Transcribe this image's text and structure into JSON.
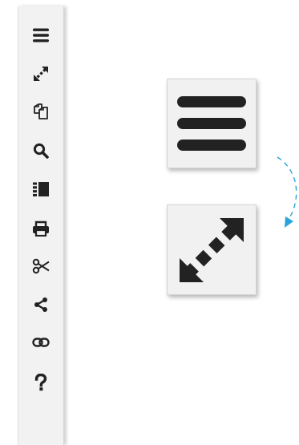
{
  "toolbar": {
    "items": [
      {
        "name": "menu",
        "icon": "hamburger-menu-icon"
      },
      {
        "name": "fullscreen",
        "icon": "expand-arrows-icon"
      },
      {
        "name": "copy-pages",
        "icon": "copy-pages-icon"
      },
      {
        "name": "search",
        "icon": "magnifier-icon"
      },
      {
        "name": "table-of-contents",
        "icon": "list-icon"
      },
      {
        "name": "print",
        "icon": "printer-icon"
      },
      {
        "name": "clip",
        "icon": "scissors-icon"
      },
      {
        "name": "share",
        "icon": "share-icon"
      },
      {
        "name": "link",
        "icon": "chain-link-icon"
      },
      {
        "name": "help",
        "icon": "question-mark-icon"
      }
    ]
  },
  "callouts": {
    "top": {
      "icon": "hamburger-menu-icon"
    },
    "bottom": {
      "icon": "expand-arrows-icon"
    },
    "connector": {
      "icon": "curved-dashed-arrow",
      "color": "#29a3dc"
    }
  },
  "colors": {
    "icon": "#222222",
    "toolbar_bg": "#f2f2f2",
    "accent_arrow": "#29a3dc"
  }
}
